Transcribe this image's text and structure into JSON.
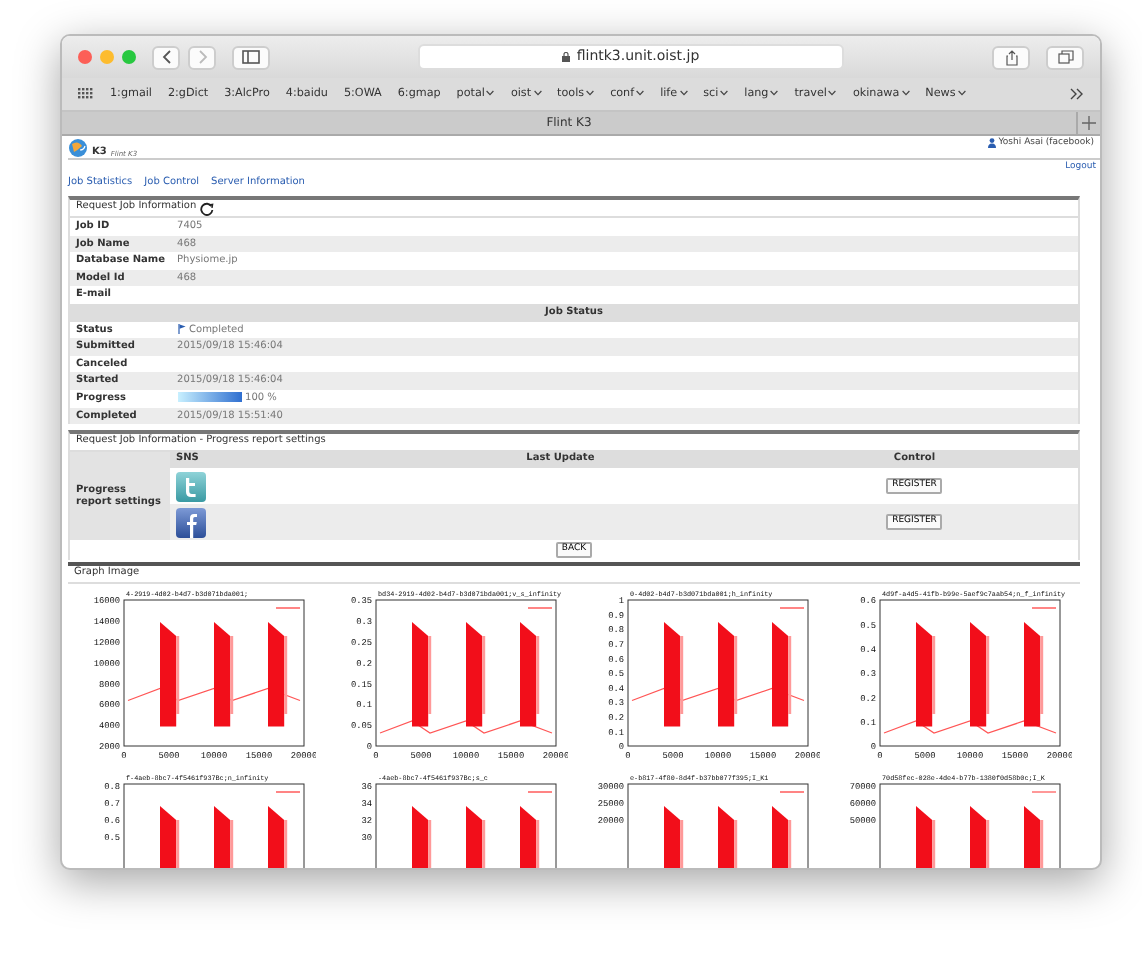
{
  "browser": {
    "url": "flintk3.unit.oist.jp",
    "tab_title": "Flint K3",
    "bookmarks": [
      {
        "label": "1:gmail",
        "dropdown": false
      },
      {
        "label": "2:gDict",
        "dropdown": false
      },
      {
        "label": "3:AlcPro",
        "dropdown": false
      },
      {
        "label": "4:baidu",
        "dropdown": false
      },
      {
        "label": "5:OWA",
        "dropdown": false
      },
      {
        "label": "6:gmap",
        "dropdown": false
      },
      {
        "label": "potal",
        "dropdown": true
      },
      {
        "label": "oist",
        "dropdown": true
      },
      {
        "label": "tools",
        "dropdown": true
      },
      {
        "label": "conf",
        "dropdown": true
      },
      {
        "label": "life",
        "dropdown": true
      },
      {
        "label": "sci",
        "dropdown": true
      },
      {
        "label": "lang",
        "dropdown": true
      },
      {
        "label": "travel",
        "dropdown": true
      },
      {
        "label": "okinawa",
        "dropdown": true
      },
      {
        "label": "News",
        "dropdown": true
      }
    ]
  },
  "header": {
    "logo_text": "K3",
    "app_name": "Flint K3",
    "user": "Yoshi Asai (facebook)",
    "logout": "Logout"
  },
  "nav": [
    "Job Statistics",
    "Job Control",
    "Server Information"
  ],
  "job_info": {
    "title": "Request Job Information",
    "rows": [
      {
        "label": "Job ID",
        "value": "7405"
      },
      {
        "label": "Job Name",
        "value": "468"
      },
      {
        "label": "Database Name",
        "value": "Physiome.jp"
      },
      {
        "label": "Model Id",
        "value": "468"
      },
      {
        "label": "E-mail"
      }
    ],
    "status_heading": "Job Status",
    "status_rows": [
      {
        "kind": "status",
        "label": "Status",
        "value": "Completed"
      },
      {
        "kind": "text",
        "label": "Submitted",
        "value": "2015/09/18 15:46:04"
      },
      {
        "kind": "text",
        "label": "Canceled"
      },
      {
        "kind": "text",
        "label": "Started",
        "value": "2015/09/18 15:46:04"
      },
      {
        "kind": "progress",
        "label": "Progress",
        "level": 1,
        "value": "100 %"
      },
      {
        "kind": "text",
        "label": "Completed",
        "value": "2015/09/18 15:51:40"
      }
    ]
  },
  "report_settings": {
    "title": "Request Job Information - Progress report settings",
    "label": "Progress report settings",
    "columns": [
      "SNS",
      "Last Update",
      "Control"
    ],
    "rows": [
      {
        "kind": "twitter",
        "button": "REGISTER"
      },
      {
        "kind": "facebook",
        "button": "REGISTER"
      }
    ]
  },
  "back_button": "BACK",
  "graphs": {
    "title": "Graph Image",
    "plots": [
      {
        "legend": "4-2919-4d02-b4d7-b3d071bda001;",
        "yticks": [
          "16000",
          "14000",
          "12000",
          "10000",
          "8000",
          "6000",
          "4000",
          "2000"
        ],
        "xticks": [
          "0",
          "5000",
          "10000",
          "15000",
          "20000"
        ]
      },
      {
        "legend": "bd34-2919-4d02-b4d7-b3d071bda001;v_s_infinity",
        "yticks": [
          "0.35",
          "0.3",
          "0.25",
          "0.2",
          "0.15",
          "0.1",
          "0.05",
          "0"
        ],
        "xticks": [
          "0",
          "5000",
          "10000",
          "15000",
          "20000"
        ]
      },
      {
        "legend": "0-4d02-b4d7-b3d071bda001;h_infinity",
        "yticks": [
          "1",
          "0.9",
          "0.8",
          "0.7",
          "0.6",
          "0.5",
          "0.4",
          "0.3",
          "0.2",
          "0.1",
          "0"
        ],
        "xticks": [
          "0",
          "5000",
          "10000",
          "15000",
          "20000"
        ]
      },
      {
        "legend": "4d9f-a4d5-41fb-b99e-5aef9c7aab54;n_f_infinity",
        "yticks": [
          "0.6",
          "0.5",
          "0.4",
          "0.3",
          "0.2",
          "0.1",
          "0"
        ],
        "xticks": [
          "0",
          "5000",
          "10000",
          "15000",
          "20000"
        ]
      },
      {
        "legend": "f-4aeb-8bc7-4f5461f937Bc;n_infinity",
        "yticks": [
          "0.8",
          "0.7",
          "0.6",
          "0.5"
        ]
      },
      {
        "legend": "-4aeb-8bc7-4f5461f937Bc;s_c",
        "yticks": [
          "36",
          "34",
          "32",
          "30"
        ]
      },
      {
        "legend": "e-b817-4f80-8d4f-b37bb077f395;I_K1",
        "yticks": [
          "30000",
          "25000",
          "20000"
        ]
      },
      {
        "legend": "70d58fec-028e-4de4-b77b-1380f0d58b0c;I_K",
        "yticks": [
          "70000",
          "60000",
          "50000"
        ]
      }
    ]
  }
}
